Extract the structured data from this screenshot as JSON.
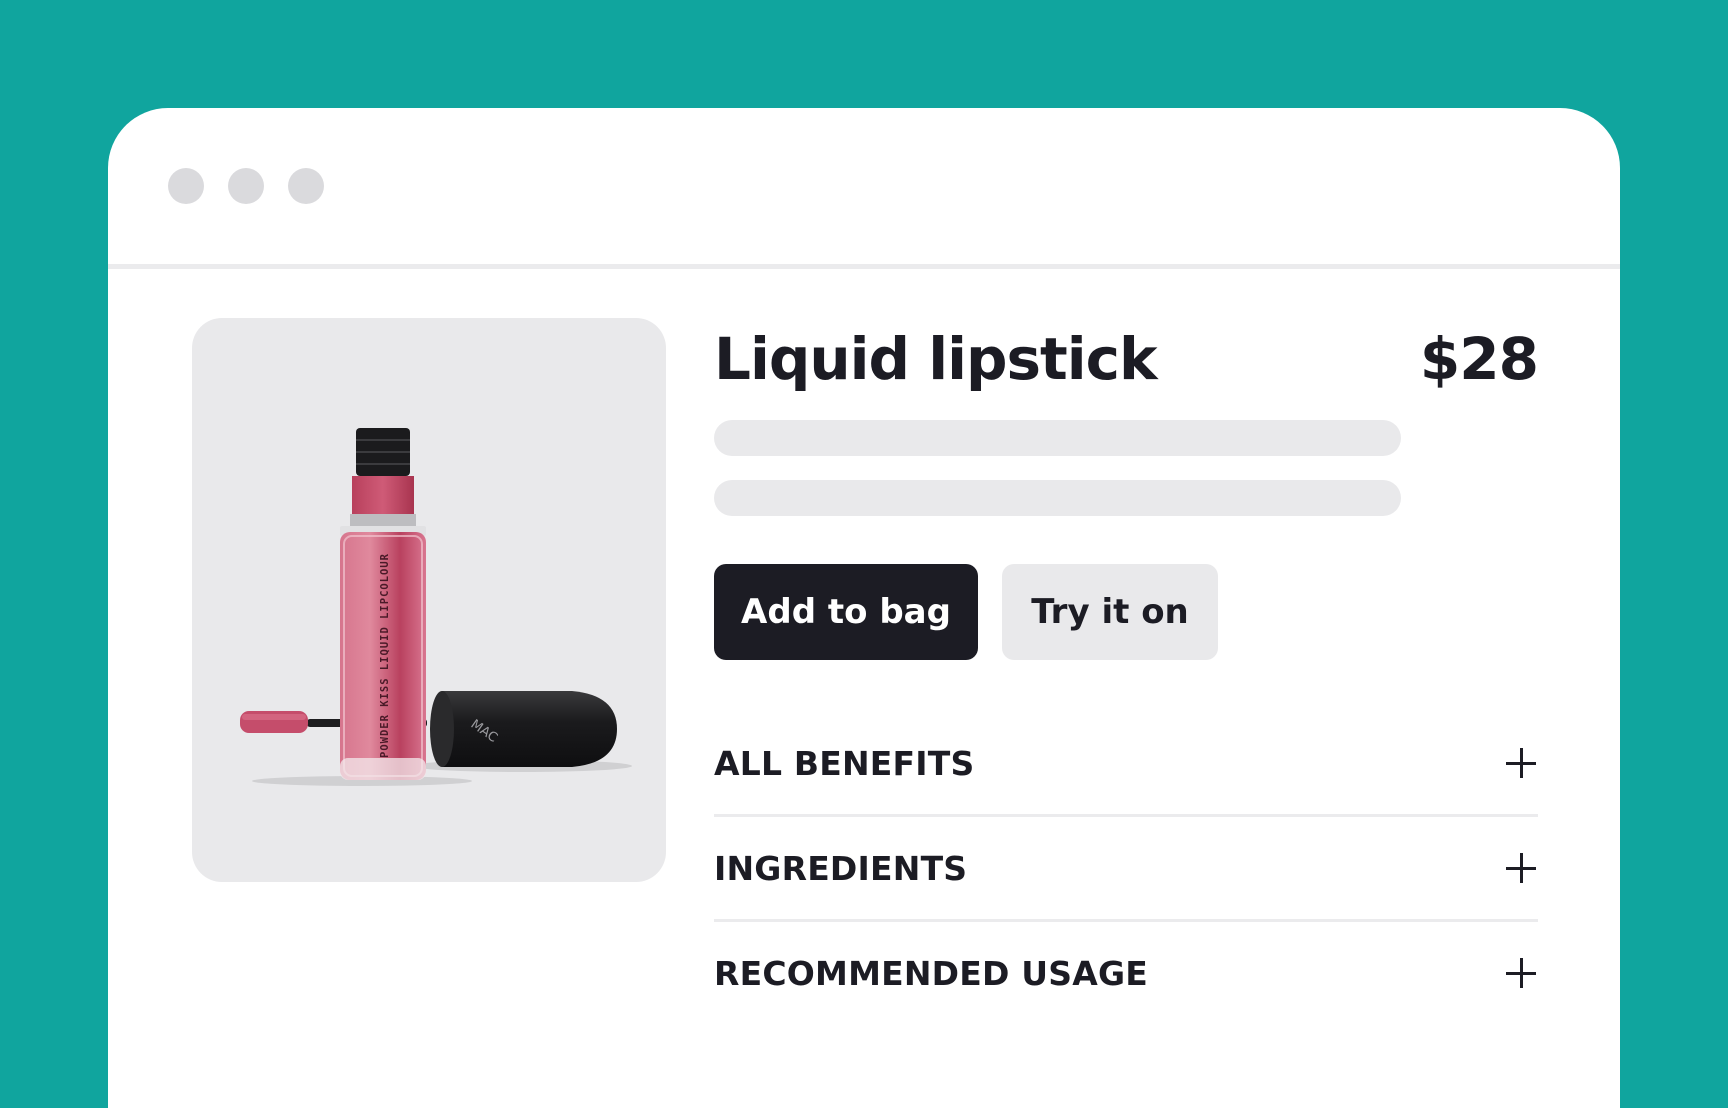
{
  "product": {
    "title": "Liquid lipstick",
    "price": "$28",
    "image": {
      "tube_text": "POWDER KISS LIQUID LIPCOLOUR",
      "cap_logo": "MAC"
    }
  },
  "actions": {
    "add_to_bag": "Add to bag",
    "try_it_on": "Try it on"
  },
  "accordion": [
    {
      "label": "ALL BENEFITS",
      "icon": "plus-icon"
    },
    {
      "label": "INGREDIENTS",
      "icon": "plus-icon"
    },
    {
      "label": "RECOMMENDED USAGE",
      "icon": "plus-icon"
    }
  ],
  "colors": {
    "background": "#10a59e",
    "primary_button": "#1c1c24",
    "secondary_button": "#e9e9eb",
    "lipstick": "#c14a68"
  }
}
